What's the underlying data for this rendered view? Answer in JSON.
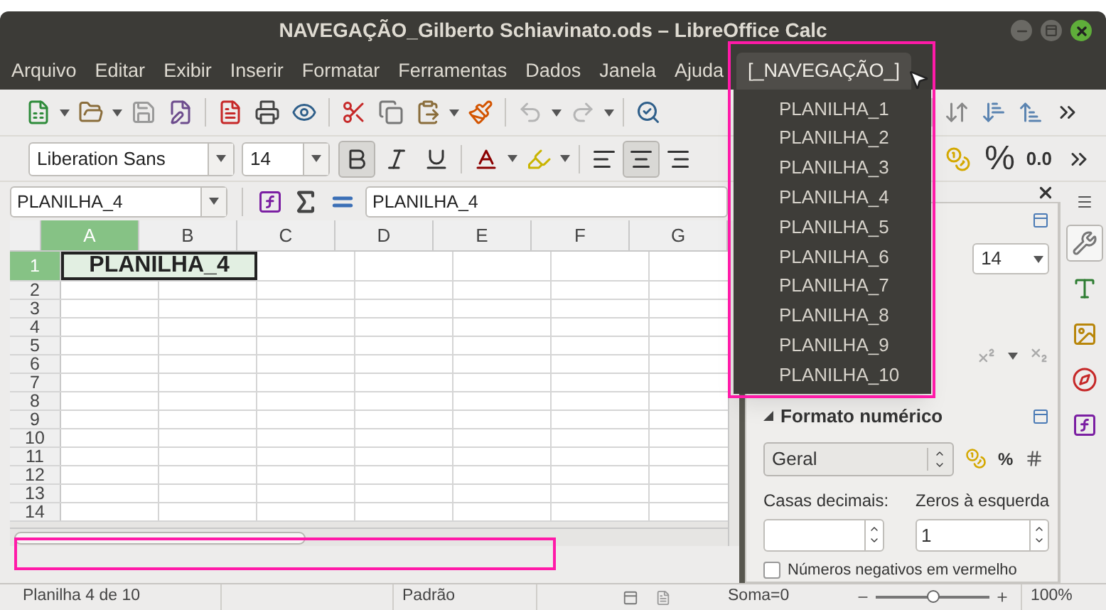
{
  "window": {
    "title": "NAVEGAÇÃO_Gilberto Schiavinato.ods – LibreOffice Calc"
  },
  "menu": [
    {
      "label": "Arquivo",
      "selected": false
    },
    {
      "label": "Editar",
      "selected": false
    },
    {
      "label": "Exibir",
      "selected": false
    },
    {
      "label": "Inserir",
      "selected": false
    },
    {
      "label": "Formatar",
      "selected": false
    },
    {
      "label": "Ferramentas",
      "selected": false
    },
    {
      "label": "Dados",
      "selected": false
    },
    {
      "label": "Janela",
      "selected": false
    },
    {
      "label": "Ajuda",
      "selected": false
    },
    {
      "label": "[_NAVEGAÇÃO_]",
      "selected": true
    }
  ],
  "dropdown": {
    "items": [
      {
        "label": "PLANILHA_1"
      },
      {
        "label": "PLANILHA_2"
      },
      {
        "label": "PLANILHA_3"
      },
      {
        "label": "PLANILHA_4"
      },
      {
        "label": "PLANILHA_5"
      },
      {
        "label": "PLANILHA_6"
      },
      {
        "label": "PLANILHA_7"
      },
      {
        "label": "PLANILHA_8"
      },
      {
        "label": "PLANILHA_9"
      },
      {
        "label": "PLANILHA_10"
      }
    ]
  },
  "format_toolbar": {
    "font_name": "Liberation Sans",
    "font_size": "14",
    "text_format": [
      {
        "kind": "bold",
        "pressed": true
      },
      {
        "kind": "italic",
        "pressed": false
      },
      {
        "kind": "underline",
        "pressed": false
      }
    ],
    "alignment": [
      {
        "kind": "left",
        "selected": false
      },
      {
        "kind": "center",
        "selected": true
      },
      {
        "kind": "right",
        "selected": false
      }
    ],
    "percent_button": "%",
    "decimal_button": "0.0"
  },
  "formula_bar": {
    "name_box": "PLANILHA_4",
    "formula": "PLANILHA_4"
  },
  "sheet": {
    "columns": [
      {
        "label": "A",
        "selected": true
      },
      {
        "label": "B",
        "selected": false
      },
      {
        "label": "C",
        "selected": false
      },
      {
        "label": "D",
        "selected": false
      },
      {
        "label": "E",
        "selected": false
      },
      {
        "label": "F",
        "selected": false
      },
      {
        "label": "G",
        "selected": false
      }
    ],
    "rows": [
      {
        "label": "1",
        "selected": true
      },
      {
        "label": "2",
        "selected": false
      },
      {
        "label": "3",
        "selected": false
      },
      {
        "label": "4",
        "selected": false
      },
      {
        "label": "5",
        "selected": false
      },
      {
        "label": "6",
        "selected": false
      },
      {
        "label": "7",
        "selected": false
      },
      {
        "label": "8",
        "selected": false
      },
      {
        "label": "9",
        "selected": false
      },
      {
        "label": "10",
        "selected": false
      },
      {
        "label": "11",
        "selected": false
      },
      {
        "label": "12",
        "selected": false
      },
      {
        "label": "13",
        "selected": false
      },
      {
        "label": "14",
        "selected": false
      }
    ],
    "merged_cell": "PLANILHA_4"
  },
  "sidebar": {
    "font_size": "14",
    "number_format": {
      "title": "Formato numérico",
      "expanded": true,
      "category": "Geral",
      "percent_button": "%",
      "decimal_label": "Casas decimais:",
      "zeros_label": "Zeros à esquerda",
      "zeros_value": "1",
      "negative_red": {
        "label": "Números negativos em vermelho",
        "checked": false
      }
    },
    "tabs": [
      {
        "kind": "properties",
        "selected": true
      },
      {
        "kind": "styles",
        "selected": false
      },
      {
        "kind": "gallery",
        "selected": false
      },
      {
        "kind": "navigator",
        "selected": false
      },
      {
        "kind": "functions",
        "selected": false
      }
    ]
  },
  "status_bar": {
    "sheet": "Planilha 4 de 10",
    "style": "Padrão",
    "sum": "Soma=0",
    "zoom": {
      "level": 0.5,
      "reading": "100%"
    }
  }
}
